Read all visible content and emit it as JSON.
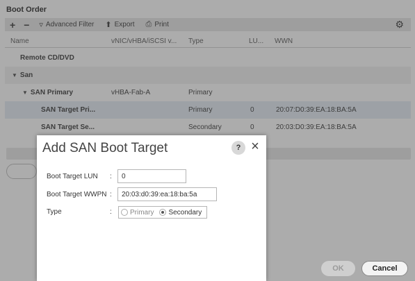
{
  "panel": {
    "title": "Boot Order"
  },
  "toolbar": {
    "add_label": "+",
    "remove_label": "−",
    "advanced_filter_label": "Advanced Filter",
    "export_label": "Export",
    "print_label": "Print"
  },
  "table": {
    "headers": [
      "Name",
      "vNIC/vHBA/iSCSI v...",
      "Type",
      "LU...",
      "WWN"
    ],
    "rows": [
      {
        "name": "Remote CD/DVD",
        "vnic": "",
        "type": "",
        "lun": "",
        "wwn": ""
      },
      {
        "name": "San",
        "vnic": "",
        "type": "",
        "lun": "",
        "wwn": ""
      },
      {
        "name": "SAN Primary",
        "vnic": "vHBA-Fab-A",
        "type": "Primary",
        "lun": "",
        "wwn": ""
      },
      {
        "name": "SAN Target Pri...",
        "vnic": "",
        "type": "Primary",
        "lun": "0",
        "wwn": "20:07:D0:39:EA:18:BA:5A"
      },
      {
        "name": "SAN Target Se...",
        "vnic": "",
        "type": "Secondary",
        "lun": "0",
        "wwn": "20:03:D0:39:EA:18:BA:5A"
      }
    ]
  },
  "footer": {
    "ok_label": "OK",
    "cancel_label": "Cancel"
  },
  "dialog": {
    "title": "Add SAN Boot Target",
    "help_label": "?",
    "close_label": "×",
    "fields": {
      "lun_label": "Boot Target LUN",
      "lun_value": "0",
      "wwpn_label": "Boot Target WWPN",
      "wwpn_value": "20:03:d0:39:ea:18:ba:5a",
      "type_label": "Type",
      "colon": ":",
      "type_options": [
        "Primary",
        "Secondary"
      ],
      "type_selected": "Secondary"
    }
  }
}
